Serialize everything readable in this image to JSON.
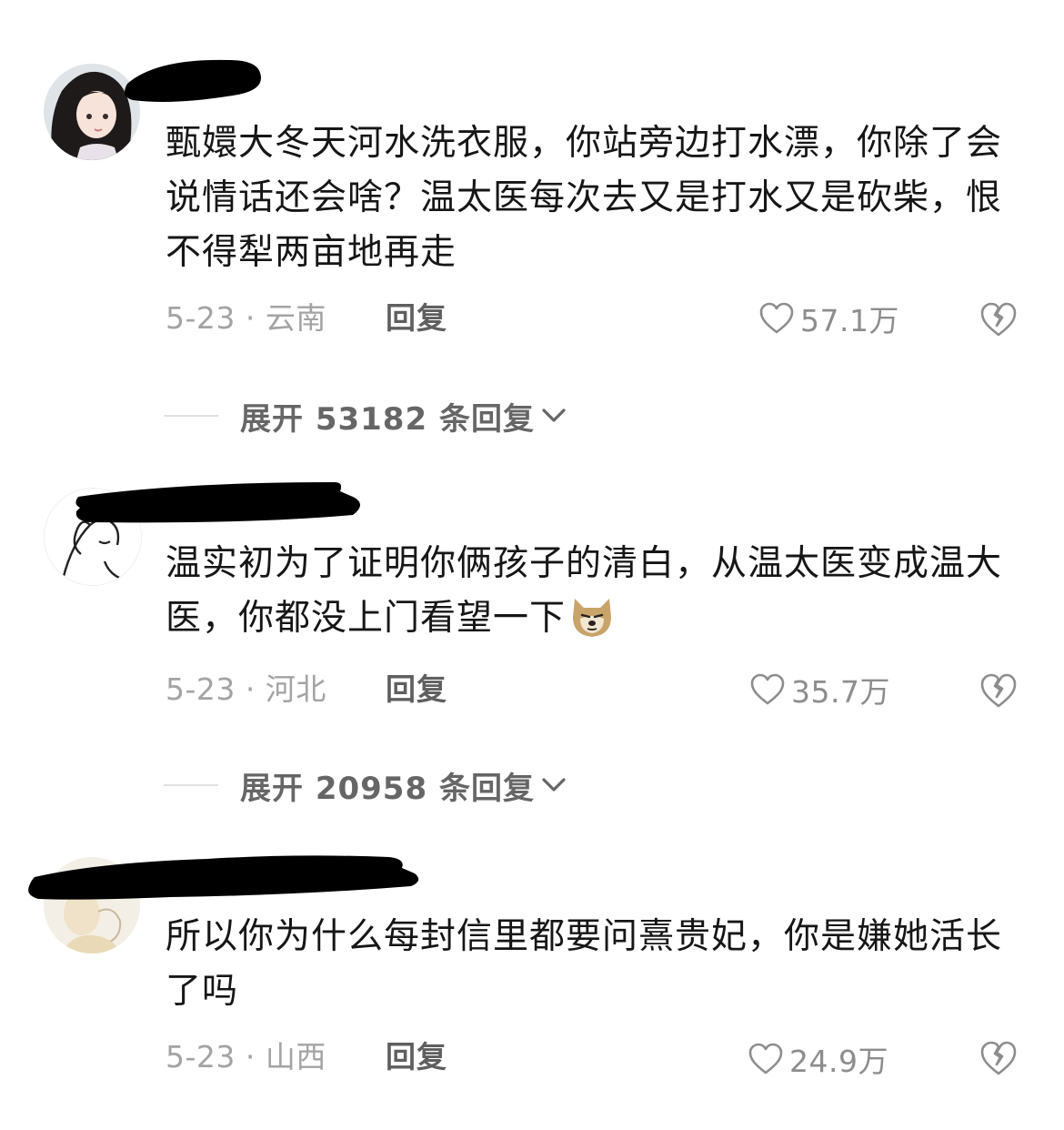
{
  "comments": [
    {
      "text": "甄嬛大冬天河水洗衣服，你站旁边打水漂，你除了会说情话还会啥？温太医每次去又是打水又是砍柴，恨不得犁两亩地再走",
      "meta": "5-23 · 云南",
      "reply_label": "回复",
      "likes": "57.1万",
      "expand_label": "展开 53182 条回复"
    },
    {
      "text": "温实初为了证明你俩孩子的清白，从温太医变成温大医，你都没上门看望一下",
      "emoji": "dog-emoji",
      "meta": "5-23 · 河北",
      "reply_label": "回复",
      "likes": "35.7万",
      "expand_label": "展开 20958 条回复"
    },
    {
      "text": "所以你为什么每封信里都要问熹贵妃，你是嫌她活长了吗",
      "meta": "5-23 · 山西",
      "reply_label": "回复",
      "likes": "24.9万"
    }
  ],
  "icons": {
    "like": "heart-outline-icon",
    "dislike": "broken-heart-icon",
    "expand": "chevron-down-icon"
  },
  "colors": {
    "text": "#161616",
    "meta": "#a3a3a3",
    "reply": "#5f5f5f",
    "redaction": "#000000"
  }
}
